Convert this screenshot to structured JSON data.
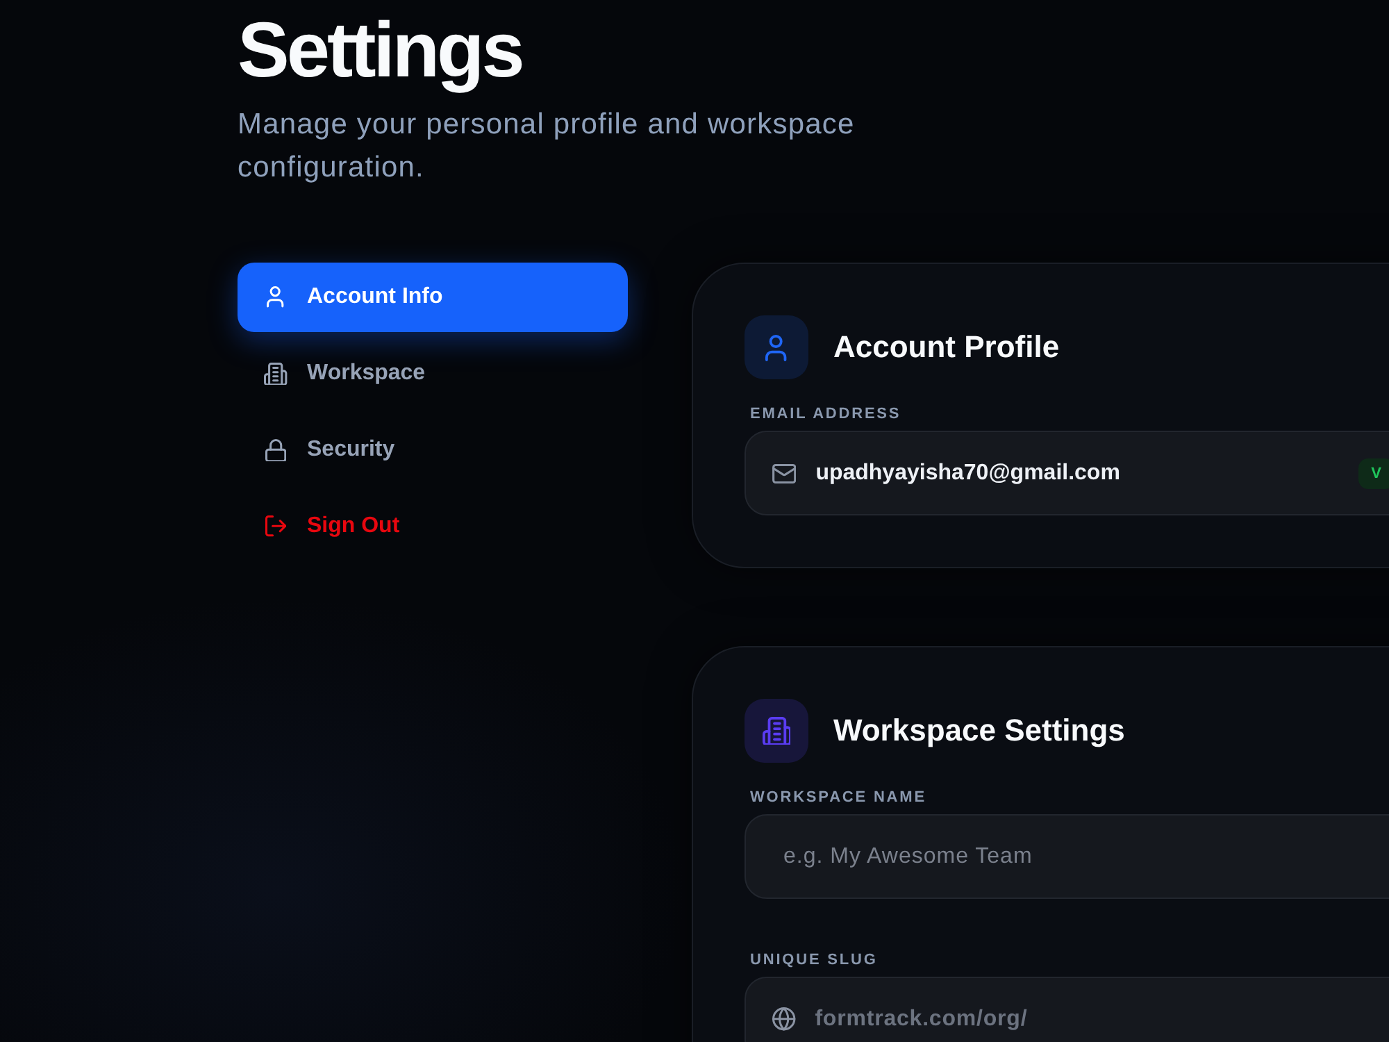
{
  "header": {
    "title": "Settings",
    "subtitle": "Manage your personal profile and workspace configuration."
  },
  "nav": {
    "items": [
      {
        "label": "Account Info",
        "kind": "tab",
        "selected": true
      },
      {
        "label": "Workspace",
        "kind": "tab",
        "selected": false
      },
      {
        "label": "Security",
        "kind": "tab",
        "selected": false
      },
      {
        "label": "Sign Out",
        "kind": "danger",
        "selected": false
      }
    ]
  },
  "cards": [
    {
      "title": "Account Profile",
      "fields": [
        {
          "label": "EMAIL ADDRESS",
          "kind": "readonly",
          "value": "upadhyayisha70@gmail.com",
          "badge": "V"
        }
      ]
    },
    {
      "title": "Workspace Settings",
      "fields": [
        {
          "label": "WORKSPACE NAME",
          "kind": "input",
          "placeholder": "e.g. My Awesome Team"
        },
        {
          "label": "UNIQUE SLUG",
          "kind": "slug",
          "prefix": "formtrack.com/org/"
        }
      ]
    }
  ]
}
